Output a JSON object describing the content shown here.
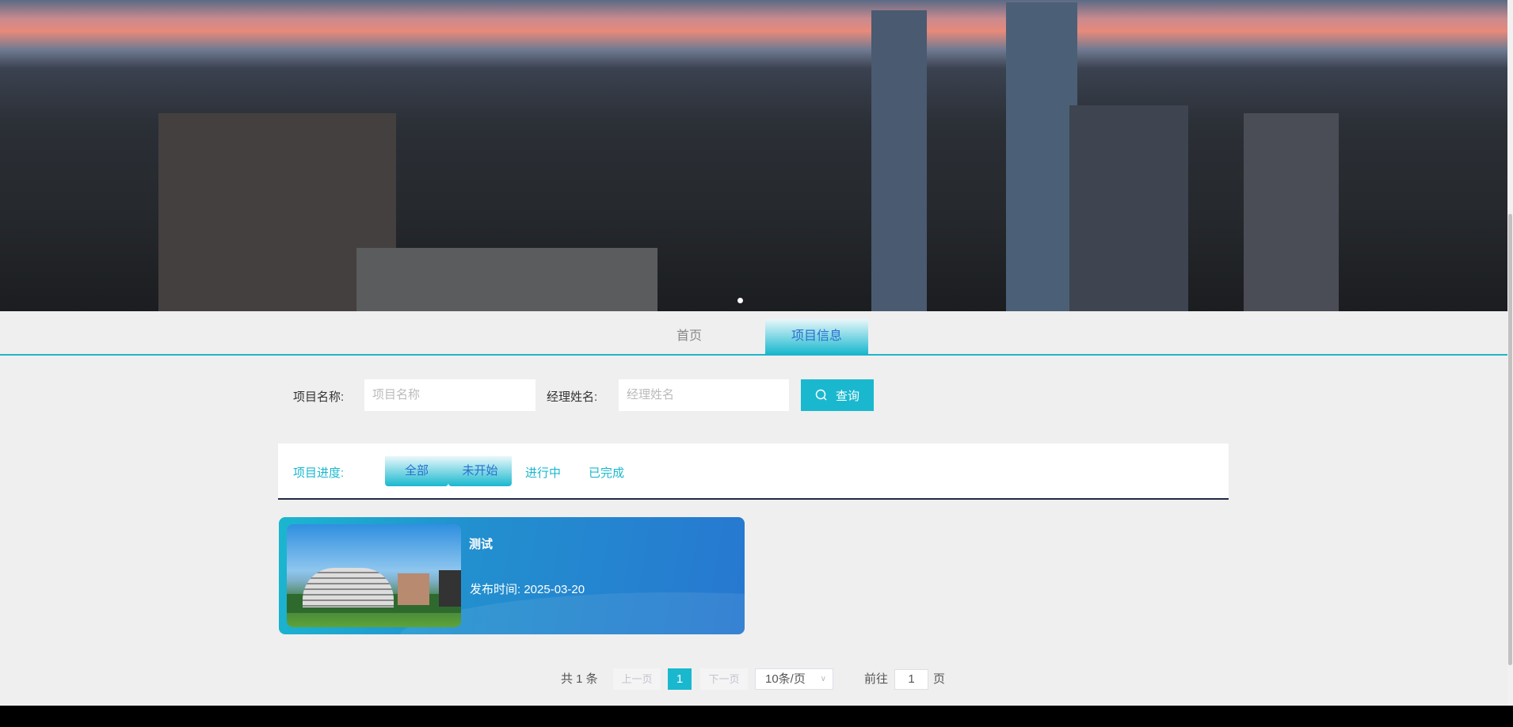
{
  "nav": {
    "tabs": [
      {
        "label": "首页"
      },
      {
        "label": "项目信息",
        "active": true
      }
    ]
  },
  "search": {
    "name_label": "项目名称:",
    "name_placeholder": "项目名称",
    "manager_label": "经理姓名:",
    "manager_placeholder": "经理姓名",
    "query_label": "查询"
  },
  "filter": {
    "label": "项目进度:",
    "options": [
      {
        "label": "全部"
      },
      {
        "label": "未开始"
      },
      {
        "label": "进行中"
      },
      {
        "label": "已完成"
      }
    ]
  },
  "projects": [
    {
      "title": "测试",
      "date": "发布时间: 2025-03-20"
    }
  ],
  "pagination": {
    "total": "共 1 条",
    "prev": "上一页",
    "current": "1",
    "next": "下一页",
    "page_size": "10条/页",
    "goto_label": "前往",
    "goto_value": "1",
    "page_suffix": "页"
  },
  "colors": {
    "accent": "#1ab8cf",
    "link": "#2a6fcf"
  }
}
